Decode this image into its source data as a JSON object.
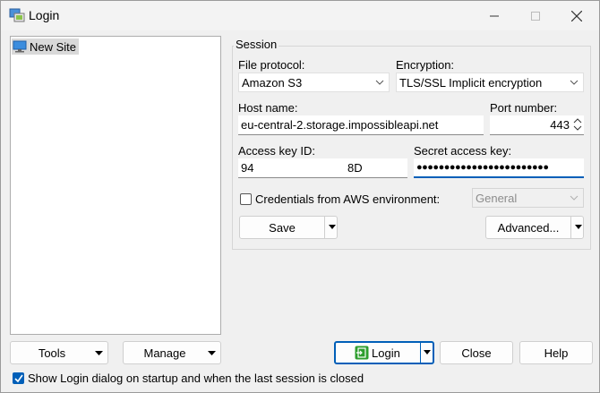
{
  "window": {
    "title": "Login"
  },
  "sites": {
    "items": [
      {
        "label": "New Site"
      }
    ]
  },
  "session": {
    "group_title": "Session",
    "file_protocol_label": "File protocol:",
    "file_protocol_value": "Amazon S3",
    "encryption_label": "Encryption:",
    "encryption_value": "TLS/SSL Implicit encryption",
    "host_label": "Host name:",
    "host_value": "eu-central-2.storage.impossibleapi.net",
    "port_label": "Port number:",
    "port_value": "443",
    "access_key_label": "Access key ID:",
    "access_key_value_start": "94",
    "access_key_value_end": "8D",
    "secret_label": "Secret access key:",
    "secret_value": "●●●●●●●●●●●●●●●●●●●●●●●●",
    "aws_env_label": "Credentials from AWS environment:",
    "aws_env_value": "General",
    "save_label": "Save",
    "advanced_label": "Advanced..."
  },
  "footer": {
    "tools_label": "Tools",
    "manage_label": "Manage",
    "login_label": "Login",
    "close_label": "Close",
    "help_label": "Help",
    "startup_label": "Show Login dialog on startup and when the last session is closed"
  },
  "colors": {
    "accent": "#005fb8",
    "tree_selection": "#d9d9d9",
    "login_icon": "#2e9e2e"
  }
}
